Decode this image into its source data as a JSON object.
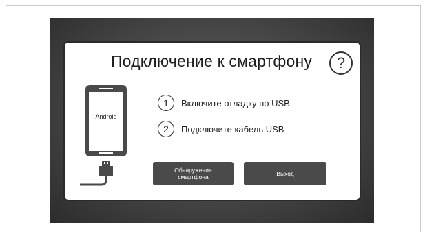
{
  "dialog": {
    "title": "Подключение к смартфону",
    "help_label": "?"
  },
  "phone": {
    "screen_label": "Android"
  },
  "steps": [
    {
      "number": "1",
      "text": "Включите отладку по USB"
    },
    {
      "number": "2",
      "text": "Подключите кабель USB"
    }
  ],
  "buttons": {
    "detect_line1": "Обнаружение",
    "detect_line2": "смартфона",
    "exit": "Выход"
  },
  "colors": {
    "dialog_border": "#2a2a2a",
    "button_bg": "#4a4a4a",
    "phone_body": "#4a4a4a",
    "screen_bg": "#3a3a3a"
  },
  "icons": [
    "help-icon",
    "smartphone-icon",
    "usb-cable-icon"
  ]
}
